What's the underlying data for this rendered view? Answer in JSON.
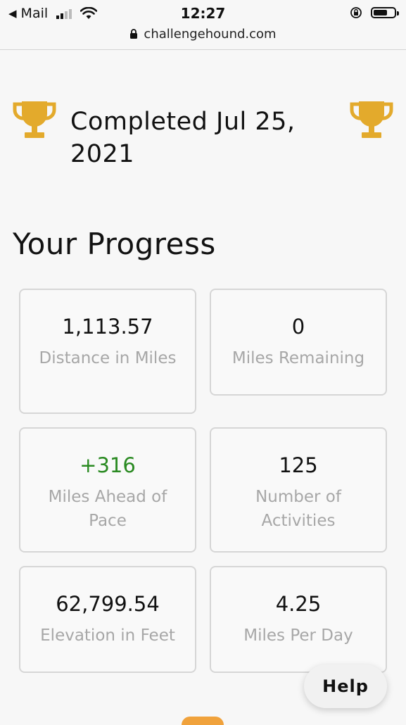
{
  "status_bar": {
    "back_app": "Mail",
    "time": "12:27",
    "url": "challengehound.com"
  },
  "header": {
    "completed_text": "Completed Jul 25, 2021",
    "trophy_color": "#e3aa2c"
  },
  "progress": {
    "title": "Your Progress",
    "cards": [
      {
        "value": "1,113.57",
        "label": "Distance in Miles"
      },
      {
        "value": "0",
        "label": "Miles Remaining"
      },
      {
        "value": "+316",
        "label": "Miles Ahead of Pace",
        "value_color": "#2a8a22"
      },
      {
        "value": "125",
        "label": "Number of Activities"
      },
      {
        "value": "62,799.54",
        "label": "Elevation in Feet"
      },
      {
        "value": "4.25",
        "label": "Miles Per Day"
      }
    ]
  },
  "help_button": {
    "label": "Help"
  }
}
